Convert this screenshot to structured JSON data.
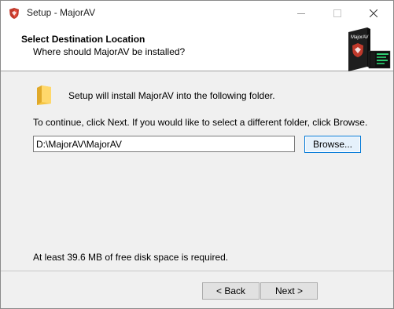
{
  "window": {
    "title": "Setup - MajorAV",
    "controls": {
      "minimize": "minimize-icon",
      "maximize": "maximize-icon",
      "close": "close-icon"
    }
  },
  "header": {
    "title": "Select Destination Location",
    "subtitle": "Where should MajorAV be installed?",
    "product_box_label": "MajorAV"
  },
  "body": {
    "install_text": "Setup will install MajorAV into the following folder.",
    "continue_text": "To continue, click Next. If you would like to select a different folder, click Browse.",
    "path_value": "D:\\MajorAV\\MajorAV",
    "browse_label": "Browse...",
    "space_text": "At least 39.6 MB of free disk space is required."
  },
  "footer": {
    "back_label": "< Back",
    "next_label": "Next >"
  },
  "colors": {
    "accent": "#0078d7",
    "brand_red": "#c0392b"
  }
}
